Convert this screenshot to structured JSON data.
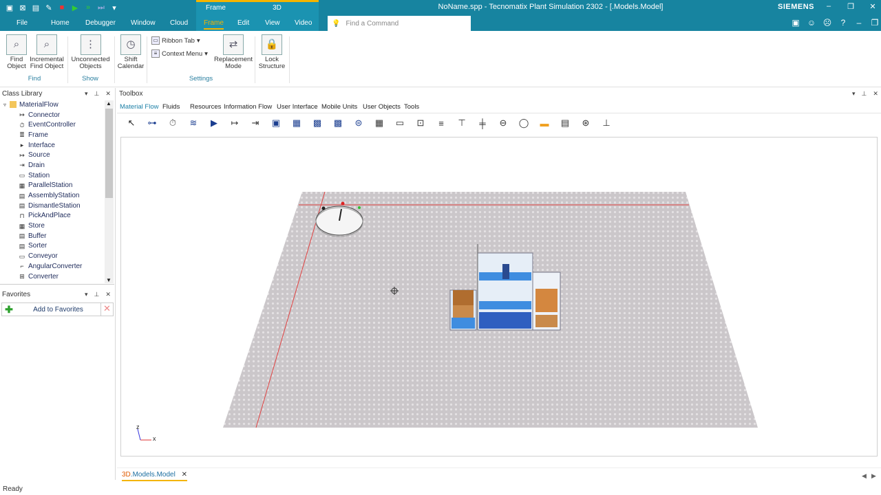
{
  "window": {
    "title": "NoName.spp - Tecnomatix Plant Simulation 2302 - [.Models.Model]",
    "brand": "SIEMENS",
    "context_group_frame": "Frame",
    "context_group_3d": "3D"
  },
  "tabs": [
    "File",
    "Home",
    "Debugger",
    "Window",
    "Cloud",
    "Frame",
    "Edit",
    "View",
    "Video"
  ],
  "active_tab": "Frame",
  "command_search": {
    "placeholder": "Find a Command"
  },
  "ribbon": {
    "find_object": "Find Object",
    "incremental_find_object": "Incremental Find Object",
    "unconnected_objects": "Unconnected Objects",
    "shift_calendar": "Shift Calendar",
    "ribbon_tab": "Ribbon Tab",
    "context_menu": "Context Menu",
    "replacement_mode": "Replacement Mode",
    "lock_structure": "Lock Structure",
    "group_find": "Find",
    "group_show": "Show",
    "group_settings": "Settings"
  },
  "class_library": {
    "title": "Class Library",
    "items": [
      {
        "label": "MaterialFlow",
        "icon": "folder-icon"
      },
      {
        "label": "Connector",
        "icon": "connector-icon"
      },
      {
        "label": "EventController",
        "icon": "clock-icon"
      },
      {
        "label": "Frame",
        "icon": "frame-icon"
      },
      {
        "label": "Interface",
        "icon": "interface-icon"
      },
      {
        "label": "Source",
        "icon": "source-icon"
      },
      {
        "label": "Drain",
        "icon": "drain-icon"
      },
      {
        "label": "Station",
        "icon": "station-icon"
      },
      {
        "label": "ParallelStation",
        "icon": "parallel-station-icon"
      },
      {
        "label": "AssemblyStation",
        "icon": "assembly-station-icon"
      },
      {
        "label": "DismantleStation",
        "icon": "dismantle-station-icon"
      },
      {
        "label": "PickAndPlace",
        "icon": "pick-and-place-icon"
      },
      {
        "label": "Store",
        "icon": "store-icon"
      },
      {
        "label": "Buffer",
        "icon": "buffer-icon"
      },
      {
        "label": "Sorter",
        "icon": "sorter-icon"
      },
      {
        "label": "Conveyor",
        "icon": "conveyor-icon"
      },
      {
        "label": "AngularConverter",
        "icon": "angular-converter-icon"
      },
      {
        "label": "Converter",
        "icon": "converter-icon"
      }
    ]
  },
  "favorites": {
    "title": "Favorites",
    "add_label": "Add to Favorites"
  },
  "toolbox": {
    "title": "Toolbox",
    "tabs": [
      "Material Flow",
      "Fluids",
      "Resources",
      "Information Flow",
      "User Interface",
      "Mobile Units",
      "User Objects",
      "Tools"
    ],
    "active_tab": "Material Flow"
  },
  "axes": {
    "z": "z",
    "x": "x"
  },
  "document_tab": {
    "prefix": "3D",
    "label": ".Models.Model"
  },
  "status": "Ready",
  "colors": {
    "titlebar": "#1784a0",
    "accent": "#f4b400",
    "floor": "#c9c5c8"
  }
}
